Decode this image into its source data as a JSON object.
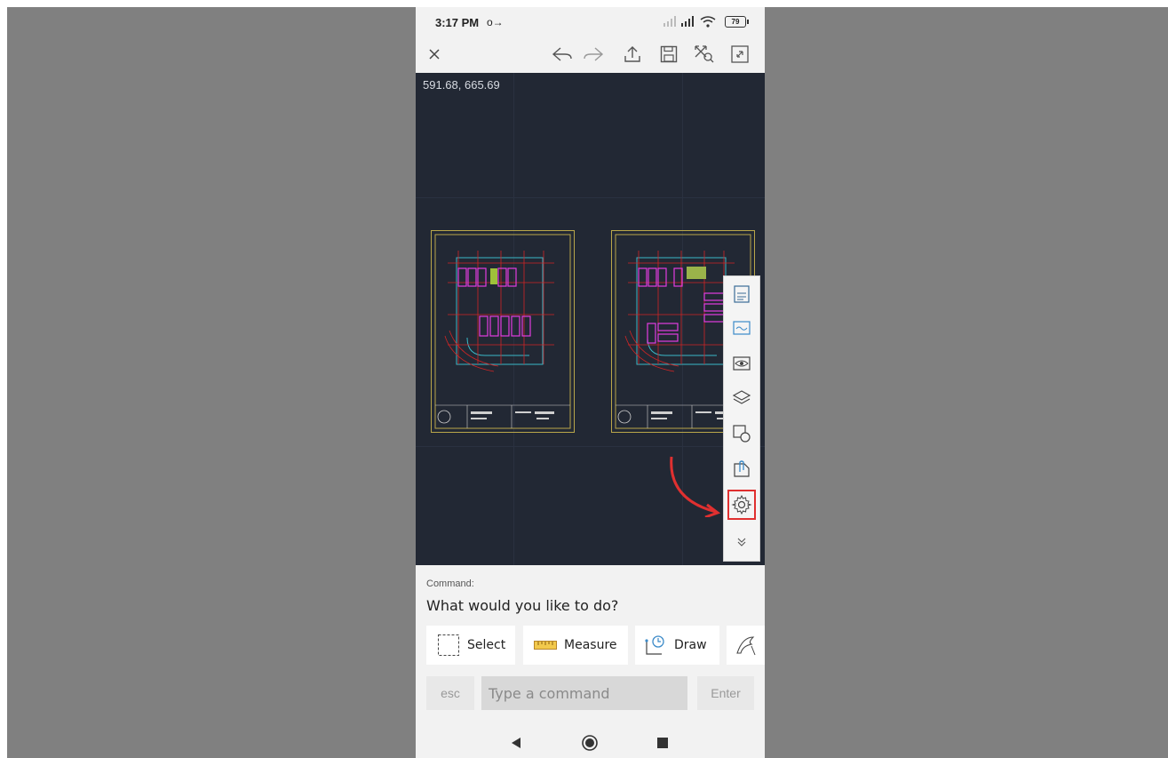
{
  "status_bar": {
    "time": "3:17 PM",
    "key_glyph": "o→",
    "battery": "79"
  },
  "toolbar": {
    "close_icon": "close-icon",
    "undo_icon": "undo-icon",
    "redo_icon": "redo-icon",
    "share_icon": "share-icon",
    "save_icon": "save-icon",
    "zoom_extents_icon": "zoom-extents-icon",
    "fullscreen_icon": "fullscreen-icon"
  },
  "canvas": {
    "coordinates": "591.68, 665.69",
    "background": "#222834"
  },
  "side_panel": {
    "tools": [
      "properties-icon",
      "sheets-icon",
      "view-icon",
      "layers-icon",
      "blocks-icon",
      "attachments-icon",
      "settings-icon"
    ],
    "highlight_color": "#e03030",
    "collapse_icon": "collapse-icon"
  },
  "command": {
    "label": "Command:",
    "prompt": "What would you like to do?",
    "actions": [
      {
        "label": "Select",
        "icon": "select-icon"
      },
      {
        "label": "Measure",
        "icon": "ruler-icon"
      },
      {
        "label": "Draw",
        "icon": "draw-icon"
      }
    ],
    "more_icon": "markup-icon",
    "esc_label": "esc",
    "input_placeholder": "Type a command",
    "enter_label": "Enter"
  },
  "nav": {
    "back_icon": "back-icon",
    "home_icon": "home-icon",
    "recents_icon": "recents-icon"
  },
  "colors": {
    "accent_red": "#e03030",
    "magenta": "#e23ce0",
    "cyan": "#3ab8c8",
    "drawing_red": "#d02525",
    "frame": "#b9a64a"
  }
}
